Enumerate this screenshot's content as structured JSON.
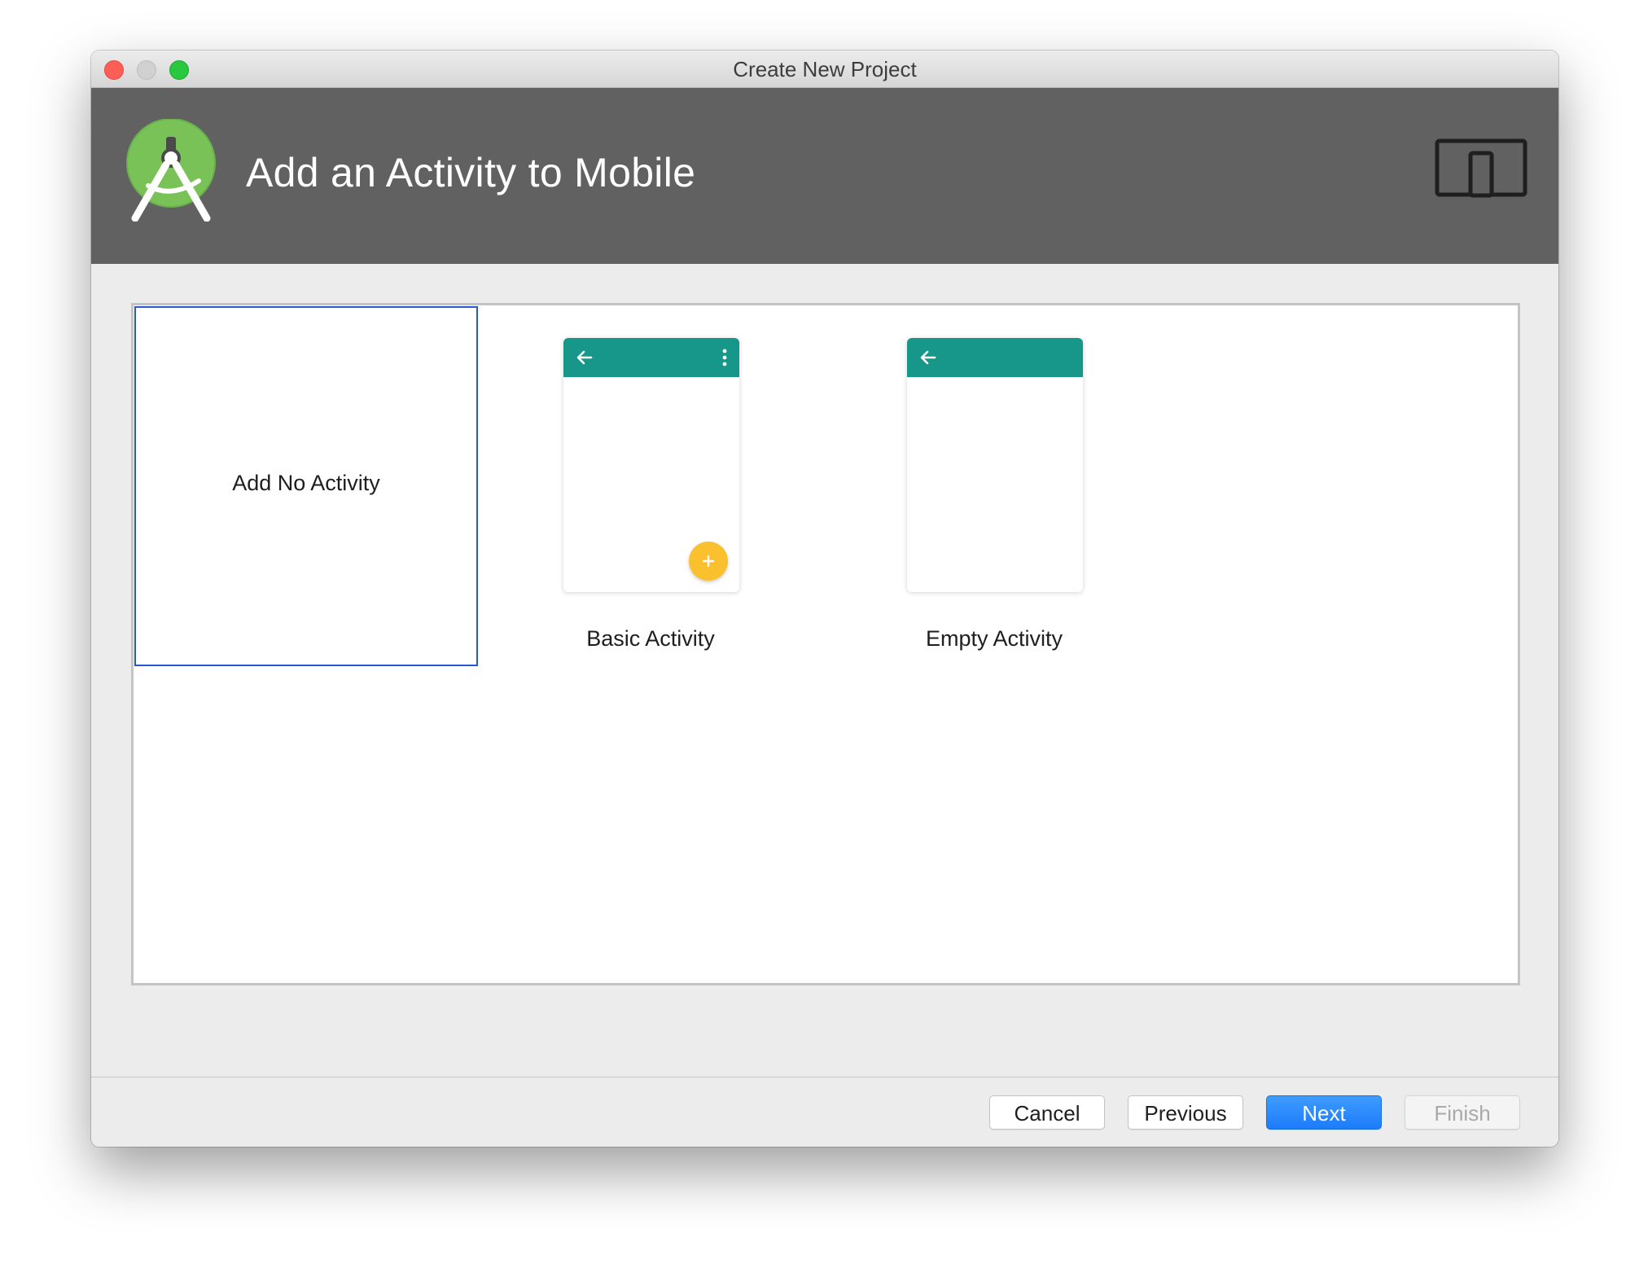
{
  "window": {
    "title": "Create New Project"
  },
  "header": {
    "title": "Add an Activity to Mobile",
    "logo_icon": "android-studio-logo-icon",
    "form_factor_icon": "mobile-tablet-icon",
    "background": "#616161"
  },
  "gallery": {
    "selected_index": 0,
    "templates": [
      {
        "label": "Add No Activity",
        "selected": true
      },
      {
        "label": "Basic Activity",
        "has_menu": true,
        "has_fab": true,
        "fab_symbol": "+"
      },
      {
        "label": "Empty Activity",
        "has_menu": false,
        "has_fab": false
      }
    ]
  },
  "footer": {
    "cancel_label": "Cancel",
    "previous_label": "Previous",
    "next_label": "Next",
    "finish_label": "Finish"
  },
  "colors": {
    "app_bar": "#17978a",
    "fab": "#fbc02d",
    "selection": "#2856d6",
    "primary_button": "#1c7bfa",
    "close": "#fd5f57",
    "maximize": "#28c83f"
  }
}
